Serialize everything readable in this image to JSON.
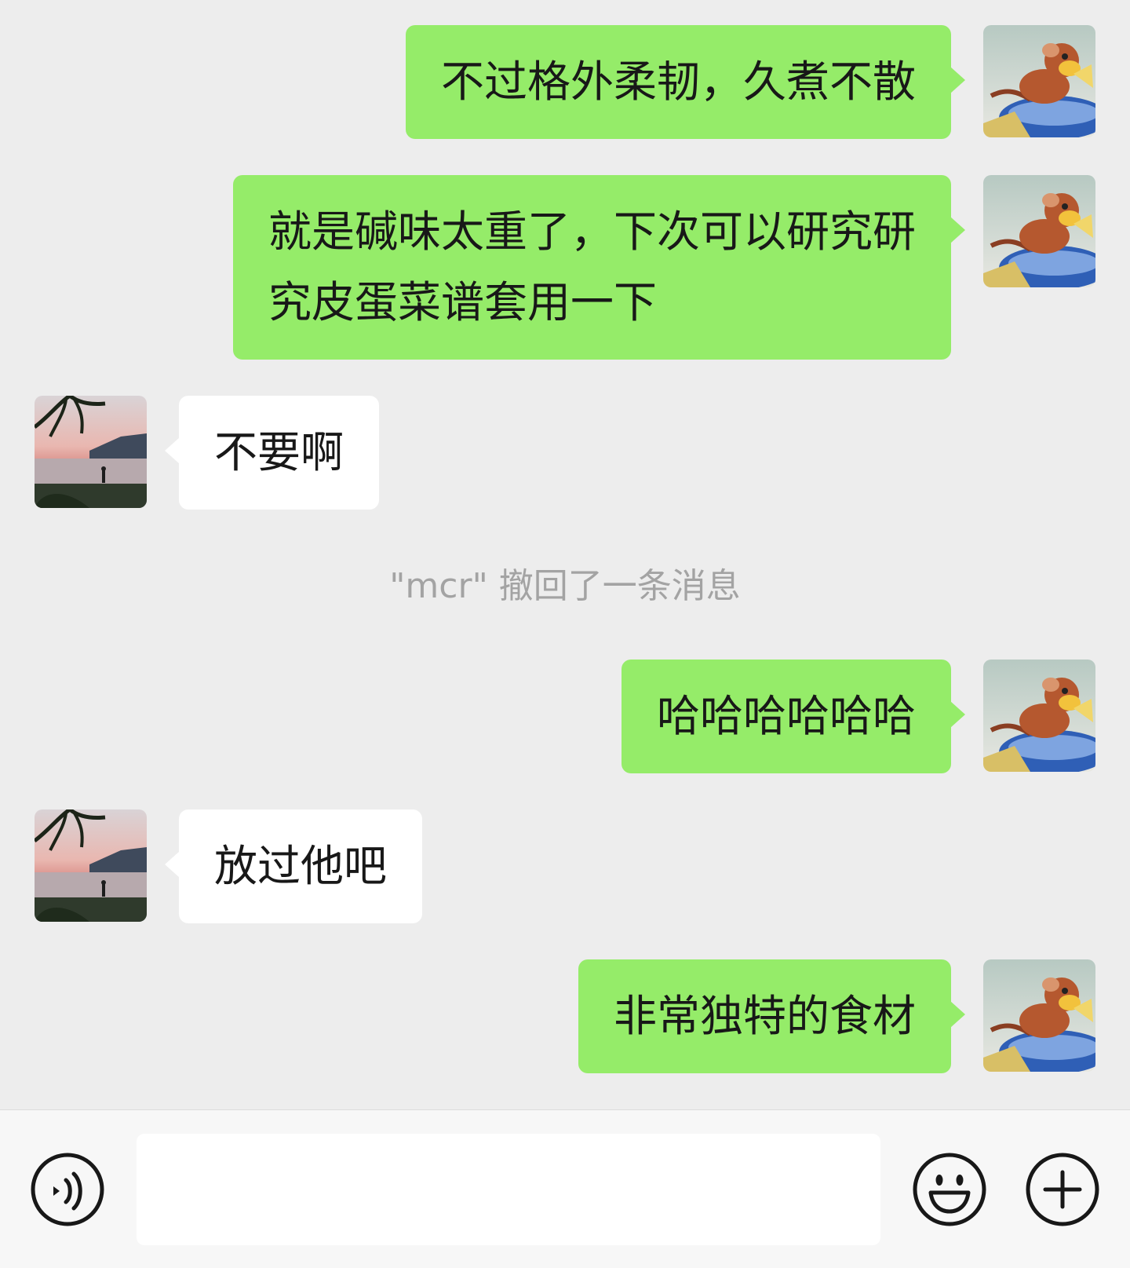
{
  "messages": [
    {
      "id": "m1",
      "side": "out",
      "lines": [
        "不过格外柔韧，久煮不散"
      ]
    },
    {
      "id": "m2",
      "side": "out",
      "lines": [
        "就是碱味太重了，下次可以研究研",
        "究皮蛋菜谱套用一下"
      ]
    },
    {
      "id": "m3",
      "side": "in",
      "lines": [
        "不要啊"
      ]
    },
    {
      "id": "m4",
      "side": "out",
      "lines": [
        "哈哈哈哈哈哈"
      ]
    },
    {
      "id": "m5",
      "side": "in",
      "lines": [
        "放过他吧"
      ]
    },
    {
      "id": "m6",
      "side": "out",
      "lines": [
        "非常独特的食材"
      ]
    }
  ],
  "system_notice": "\"mcr\" 撤回了一条消息",
  "input": {
    "value": "",
    "placeholder": ""
  },
  "icons": {
    "voice": "voice-icon",
    "emoji": "emoji-icon",
    "add": "plus-icon"
  },
  "colors": {
    "background": "#ededed",
    "outgoing_bubble": "#95ec69",
    "incoming_bubble": "#ffffff",
    "system_text": "#a3a3a3",
    "input_bar": "#f7f7f7"
  }
}
